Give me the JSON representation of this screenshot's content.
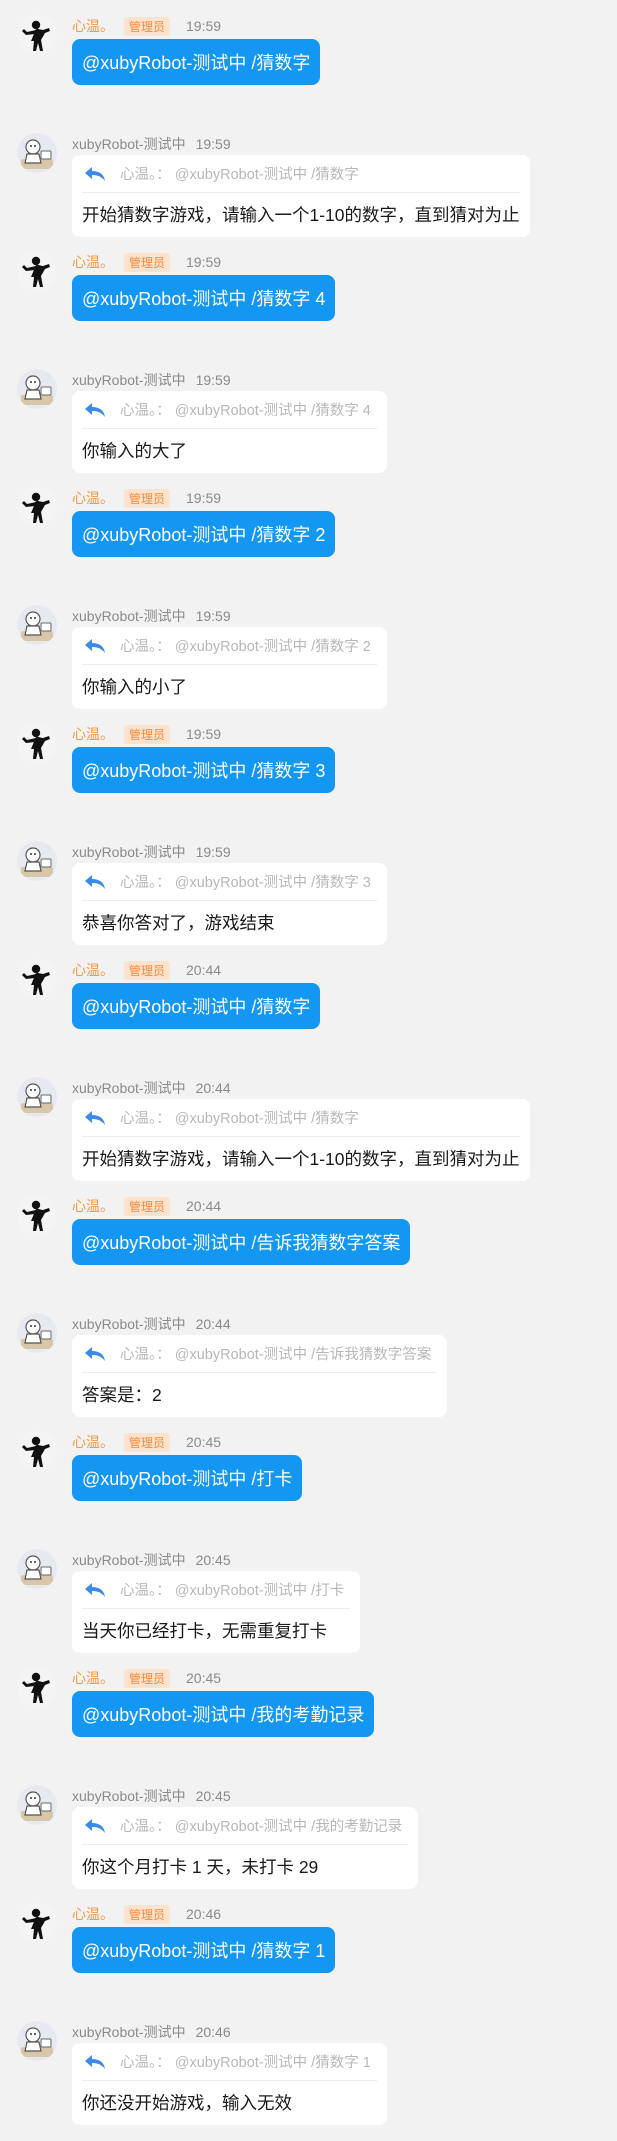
{
  "colors": {
    "background": "#f2f2f2",
    "blue_bubble": "#1397f2",
    "admin_name": "#f39b4a",
    "badge_bg": "#fde3cd",
    "badge_text": "#f08a3b",
    "reply_icon": "#3b8be8"
  },
  "icons": {
    "user_avatar": "silhouette-avatar-icon",
    "bot_avatar": "robot-avatar-icon",
    "reply": "reply-arrow-icon"
  },
  "messages": [
    {
      "kind": "user",
      "name": "心温。",
      "badge": "管理员",
      "time": "19:59",
      "text": "@xubyRobot-测试中 /猜数字"
    },
    {
      "kind": "bot",
      "name": "xubyRobot-测试中",
      "time": "19:59",
      "quote": "心温。： @xubyRobot-测试中 /猜数字",
      "text": "开始猜数字游戏，请输入一个1-10的数字，直到猜对为止"
    },
    {
      "kind": "user",
      "name": "心温。",
      "badge": "管理员",
      "time": "19:59",
      "text": "@xubyRobot-测试中 /猜数字 4"
    },
    {
      "kind": "bot",
      "name": "xubyRobot-测试中",
      "time": "19:59",
      "quote": "心温。： @xubyRobot-测试中 /猜数字 4",
      "text": "你输入的大了"
    },
    {
      "kind": "user",
      "name": "心温。",
      "badge": "管理员",
      "time": "19:59",
      "text": "@xubyRobot-测试中 /猜数字 2"
    },
    {
      "kind": "bot",
      "name": "xubyRobot-测试中",
      "time": "19:59",
      "quote": "心温。： @xubyRobot-测试中 /猜数字 2",
      "text": "你输入的小了"
    },
    {
      "kind": "user",
      "name": "心温。",
      "badge": "管理员",
      "time": "19:59",
      "text": "@xubyRobot-测试中 /猜数字 3"
    },
    {
      "kind": "bot",
      "name": "xubyRobot-测试中",
      "time": "19:59",
      "quote": "心温。： @xubyRobot-测试中 /猜数字 3",
      "text": "恭喜你答对了，游戏结束"
    },
    {
      "kind": "user",
      "name": "心温。",
      "badge": "管理员",
      "time": "20:44",
      "text": "@xubyRobot-测试中 /猜数字"
    },
    {
      "kind": "bot",
      "name": "xubyRobot-测试中",
      "time": "20:44",
      "quote": "心温。： @xubyRobot-测试中 /猜数字",
      "text": "开始猜数字游戏，请输入一个1-10的数字，直到猜对为止"
    },
    {
      "kind": "user",
      "name": "心温。",
      "badge": "管理员",
      "time": "20:44",
      "text": "@xubyRobot-测试中 /告诉我猜数字答案"
    },
    {
      "kind": "bot",
      "name": "xubyRobot-测试中",
      "time": "20:44",
      "quote": "心温。： @xubyRobot-测试中 /告诉我猜数字答案",
      "text": "答案是：2"
    },
    {
      "kind": "user",
      "name": "心温。",
      "badge": "管理员",
      "time": "20:45",
      "text": "@xubyRobot-测试中 /打卡"
    },
    {
      "kind": "bot",
      "name": "xubyRobot-测试中",
      "time": "20:45",
      "quote": "心温。： @xubyRobot-测试中 /打卡",
      "text": "当天你已经打卡，无需重复打卡"
    },
    {
      "kind": "user",
      "name": "心温。",
      "badge": "管理员",
      "time": "20:45",
      "text": "@xubyRobot-测试中 /我的考勤记录"
    },
    {
      "kind": "bot",
      "name": "xubyRobot-测试中",
      "time": "20:45",
      "quote": "心温。： @xubyRobot-测试中 /我的考勤记录",
      "text": "你这个月打卡 1 天，未打卡 29"
    },
    {
      "kind": "user",
      "name": "心温。",
      "badge": "管理员",
      "time": "20:46",
      "text": "@xubyRobot-测试中 /猜数字 1"
    },
    {
      "kind": "bot",
      "name": "xubyRobot-测试中",
      "time": "20:46",
      "quote": "心温。： @xubyRobot-测试中 /猜数字 1",
      "text": "你还没开始游戏，输入无效"
    }
  ]
}
